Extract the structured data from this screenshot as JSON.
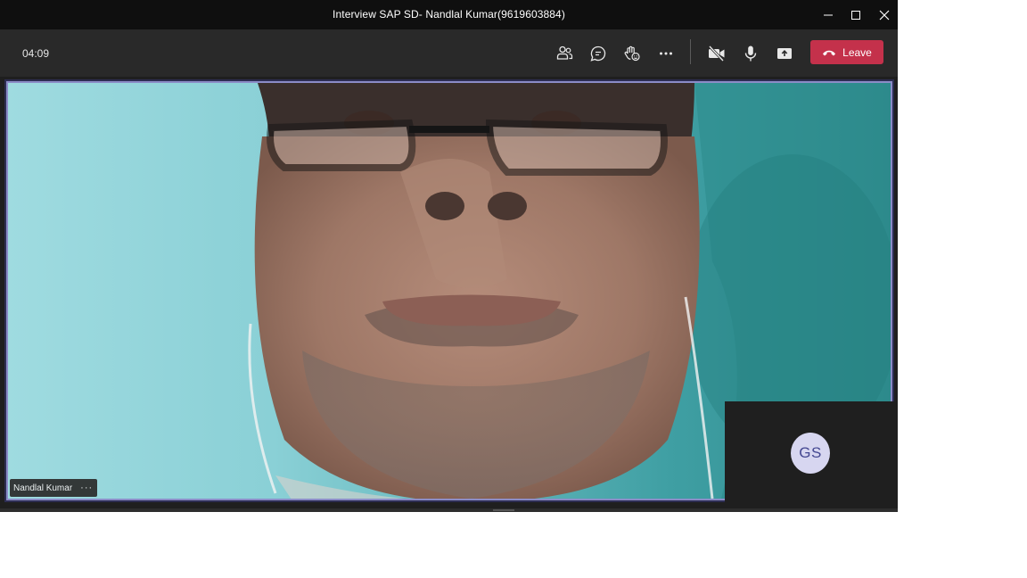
{
  "window": {
    "title": "Interview SAP SD- Nandlal Kumar(9619603884)",
    "controls": [
      "minimize-icon",
      "maximize-icon",
      "close-icon"
    ]
  },
  "toolbar": {
    "timer": "04:09",
    "buttons": [
      {
        "name": "people-icon"
      },
      {
        "name": "chat-icon"
      },
      {
        "name": "raise-hand-icon"
      },
      {
        "name": "more-options-icon"
      },
      {
        "name": "camera-off-icon"
      },
      {
        "name": "microphone-icon"
      },
      {
        "name": "share-screen-icon"
      }
    ],
    "leave_label": "Leave",
    "leave_color": "#c4314b"
  },
  "participants": {
    "main": {
      "name": "Nandlal Kumar",
      "more": "···"
    },
    "self": {
      "initials": "GS"
    }
  },
  "colors": {
    "active_border": "#8b8cc7",
    "avatar_bg": "#d7d6f0",
    "avatar_text": "#444791"
  }
}
